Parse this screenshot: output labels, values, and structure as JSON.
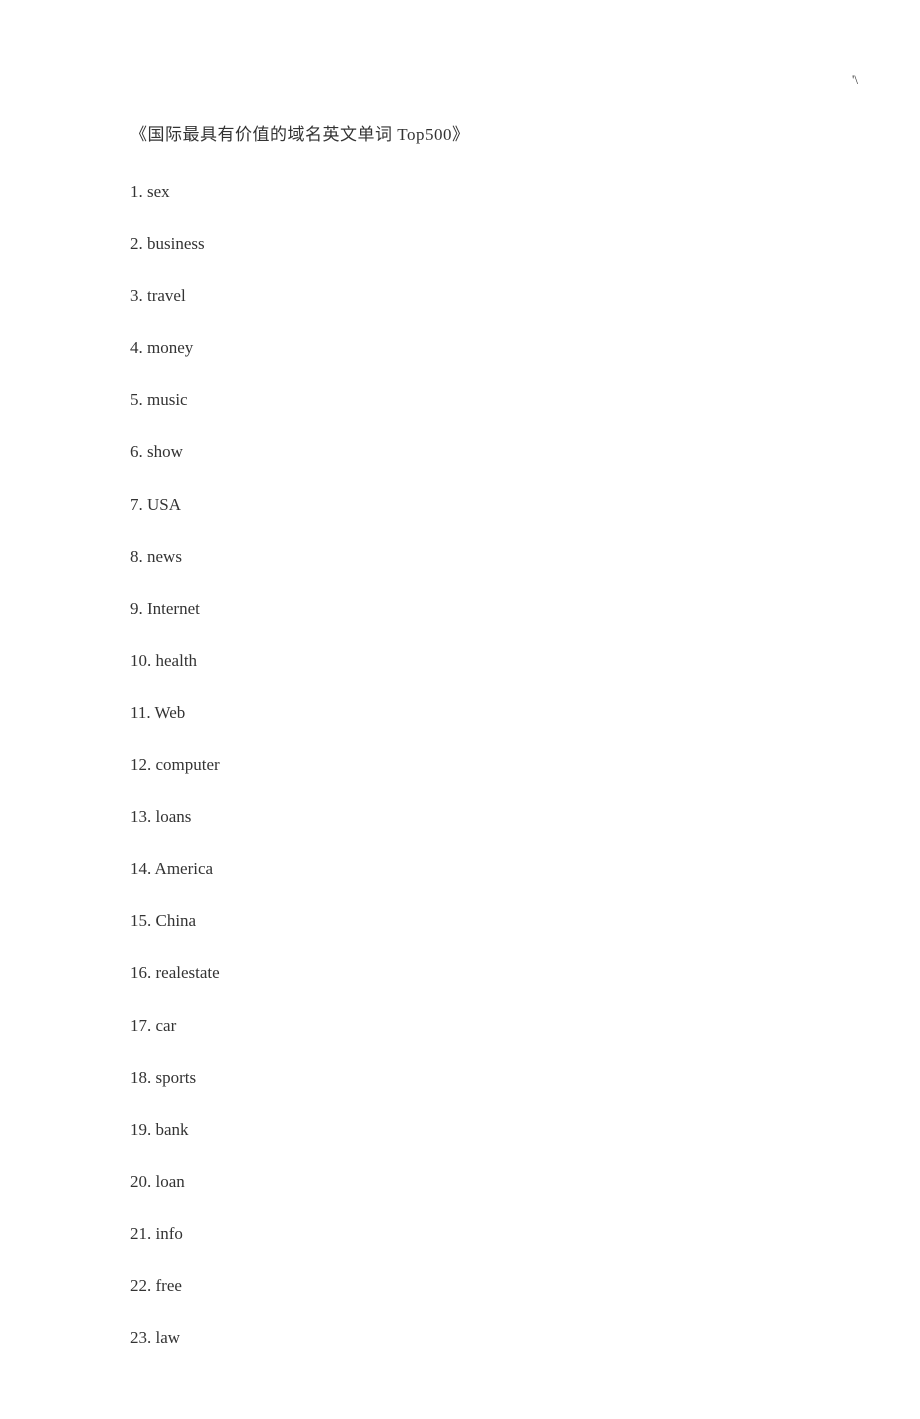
{
  "pageMark": "'\\",
  "title": "《国际最具有价值的域名英文单词 Top500》",
  "items": [
    "1. sex",
    "2. business",
    "3. travel",
    "4. money",
    "5. music",
    "6. show",
    "7. USA",
    "8. news",
    "9. Internet",
    "10. health",
    "11. Web",
    "12. computer",
    "13. loans",
    "14. America",
    "15. China",
    "16. realestate",
    "17. car",
    "18. sports",
    "19. bank",
    "20. loan",
    "21. info",
    "22. free",
    "23. law"
  ]
}
